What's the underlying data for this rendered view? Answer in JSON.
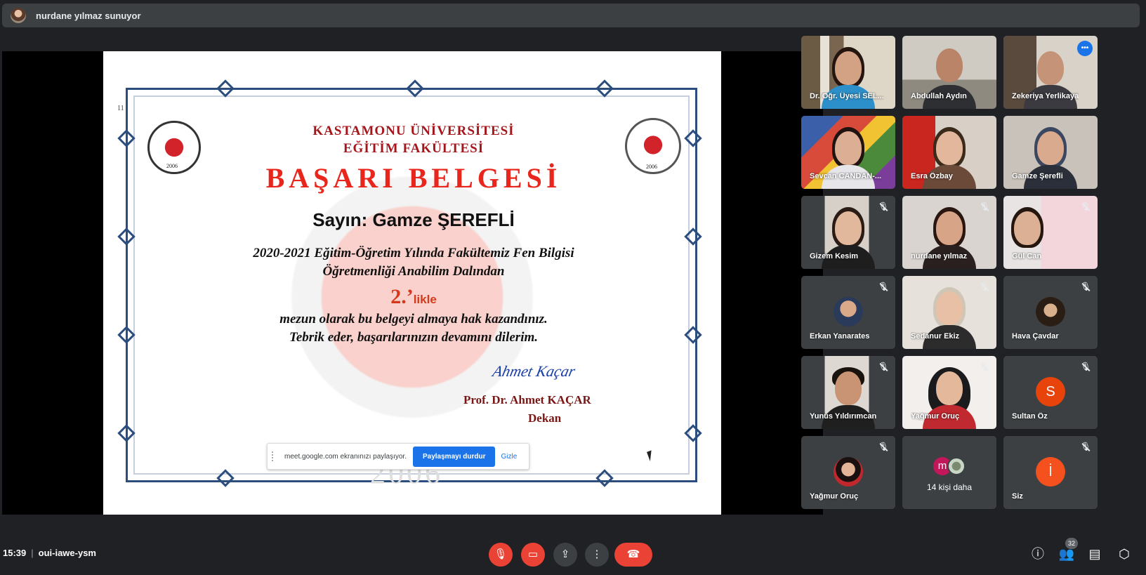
{
  "presenter_bar": {
    "text": "nurdane yılmaz sunuyor"
  },
  "certificate": {
    "university": "KASTAMONU ÜNİVERSİTESİ",
    "faculty": "EĞİTİM FAKÜLTESİ",
    "title": "BAŞARI BELGESİ",
    "recipient": "Sayın: Gamze ŞEREFLİ",
    "line1": "2020-2021 Eğitim-Öğretim Yılında Fakültemiz Fen Bilgisi",
    "line2": "Öğretmenliği Anabilim Dalından",
    "rank": "2.’",
    "rank_suffix": "likle",
    "line3": "mezun olarak bu belgeyi almaya hak kazandınız.",
    "line4": "Tebrik eder, başarılarınızın devamını dilerim.",
    "signer": "Prof. Dr. Ahmet KAÇAR",
    "signer_title": "Dekan",
    "seal_year": "2006",
    "watermark_year": "2006",
    "page_marker": "11",
    "signature": "Ahmet Kaçar"
  },
  "share_bar": {
    "message": "meet.google.com ekranınızı paylaşıyor.",
    "stop_button": "Paylaşmayı durdur",
    "hide_button": "Gizle"
  },
  "participants": [
    {
      "name": "Dr. Öğr. Üyesi SEL...",
      "muted": false
    },
    {
      "name": "Abdullah Aydın",
      "muted": false
    },
    {
      "name": "Zekeriya Yerlikaya",
      "muted": false,
      "speaking": true
    },
    {
      "name": "Sevcan CANDAN-...",
      "muted": false
    },
    {
      "name": "Esra Özbay",
      "muted": false
    },
    {
      "name": "Gamze Şerefli",
      "muted": false
    },
    {
      "name": "Gizem Kesim",
      "muted": true
    },
    {
      "name": "nurdane yılmaz",
      "muted": true
    },
    {
      "name": "Gül Can",
      "muted": true
    },
    {
      "name": "Erkan Yanarates",
      "muted": true
    },
    {
      "name": "Sedanur Ekiz",
      "muted": true
    },
    {
      "name": "Hava Çavdar",
      "muted": true
    },
    {
      "name": "Yunus Yıldırımcan",
      "muted": true
    },
    {
      "name": "Yağmur Oruç",
      "muted": true
    },
    {
      "name": "Sultan Öz",
      "muted": true,
      "avatar_letter": "S",
      "avatar_color": "#e8430a"
    },
    {
      "name": "Yağmur Oruç",
      "muted": true
    },
    {
      "name": "14 kişi daha",
      "avatar_letter": "m",
      "avatar_color": "#c2185b"
    },
    {
      "name": "Siz",
      "muted": true,
      "avatar_letter": "İ",
      "avatar_color": "#f4511e"
    }
  ],
  "bottom_bar": {
    "time": "15:39",
    "separator": "|",
    "meeting_code": "oui-iawe-ysm",
    "people_count": "32"
  },
  "colors": {
    "accent": "#1a73e8",
    "danger": "#ea4335",
    "background": "#202124",
    "tile": "#3c4043"
  }
}
